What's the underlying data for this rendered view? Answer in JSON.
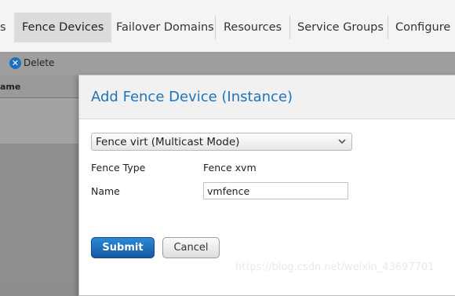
{
  "tabs": {
    "partial": "s",
    "fence_devices": "Fence Devices",
    "failover_domains": "Failover Domains",
    "resources": "Resources",
    "service_groups": "Service Groups",
    "configure": "Configure"
  },
  "toolbar": {
    "delete_label": "Delete",
    "delete_icon": "close-icon"
  },
  "table": {
    "header_partial": "ame"
  },
  "dialog": {
    "title": "Add Fence Device (Instance)",
    "fence_select": {
      "selected": "Fence virt (Multicast Mode)"
    },
    "fence_type": {
      "label": "Fence Type",
      "value": "Fence xvm"
    },
    "name": {
      "label": "Name",
      "value": "vmfence"
    },
    "submit_label": "Submit",
    "cancel_label": "Cancel"
  },
  "watermark": "https://blog.csdn.net/weixin_43697701",
  "colors": {
    "accent": "#1e73be",
    "submit": "#1d6fbf"
  }
}
